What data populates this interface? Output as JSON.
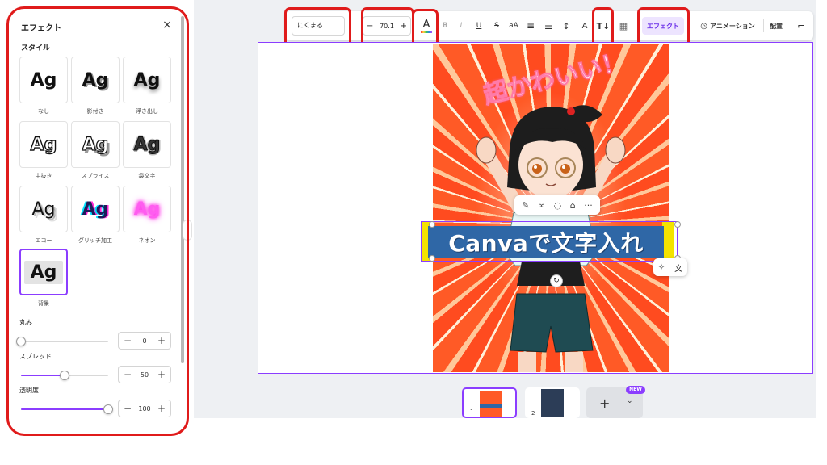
{
  "panel": {
    "title": "エフェクト",
    "section_style": "スタイル",
    "styles": [
      {
        "preview": "Ag",
        "label": "なし"
      },
      {
        "preview": "Ag",
        "label": "影付き"
      },
      {
        "preview": "Ag",
        "label": "浮き出し"
      },
      {
        "preview": "Ag",
        "label": "中抜き"
      },
      {
        "preview": "Ag",
        "label": "スプライス"
      },
      {
        "preview": "Ag",
        "label": "袋文字"
      },
      {
        "preview": "Ag",
        "label": "エコー"
      },
      {
        "preview": "Ag",
        "label": "グリッチ加工"
      },
      {
        "preview": "Ag",
        "label": "ネオン"
      },
      {
        "preview": "Ag",
        "label": "背景"
      }
    ],
    "selected_style": "背景",
    "sliders": [
      {
        "label": "丸み",
        "value": "0",
        "fraction": 0.0
      },
      {
        "label": "スプレッド",
        "value": "50",
        "fraction": 0.5
      },
      {
        "label": "透明度",
        "value": "100",
        "fraction": 1.0
      }
    ],
    "stepper_minus": "−",
    "stepper_plus": "+"
  },
  "toolbar": {
    "font": "にくまる",
    "size_minus": "−",
    "size": "70.1",
    "size_plus": "+",
    "color_glyph": "A",
    "bold": "B",
    "italic": "I",
    "underline": "U",
    "strike": "S",
    "case": "aA",
    "align_icon": "≡",
    "list_icon": "☰",
    "spacing_icon": "↕",
    "vertical_text": "A",
    "text_direction": "T↓",
    "transparency_icon": "▦",
    "effects": "エフェクト",
    "animation": "アニメーション",
    "position": "配置",
    "paint_icon": "⌐"
  },
  "canvas": {
    "art_title": "超かわいい！",
    "text": "Canvaで文字入れ"
  },
  "pages": [
    {
      "num": "1"
    },
    {
      "num": "2"
    }
  ],
  "add_page": "+",
  "new_badge": "NEW",
  "colors": {
    "accent": "#8b3dff",
    "highlight": "#e01b1b",
    "text_bg": "#2f67a6",
    "text_marker": "#f4e300"
  }
}
